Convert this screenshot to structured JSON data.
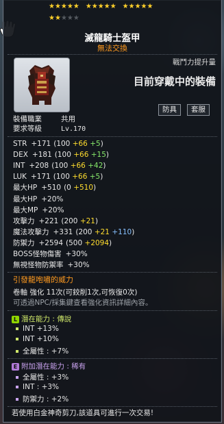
{
  "stars": {
    "row1": [
      "★★★★★",
      "★★★★★",
      "★★★★★"
    ],
    "row2_on": "★★",
    "row2_off": "★★★"
  },
  "item": {
    "name": "滅龍騎士盔甲",
    "trade": "無法交換",
    "power_label": "戰鬥力提升量",
    "power_text": "目前穿戴中的裝備",
    "tags": [
      "防具",
      "套服"
    ],
    "job_label": "裝備職業",
    "job_value": "共用",
    "level_label": "要求等級",
    "level_value": "Lv.170"
  },
  "stats": [
    {
      "name": "STR",
      "total": "+171",
      "base": "(100 ",
      "bonus": "+66",
      "extra": " +5",
      "extra_color": "g",
      "close": ")"
    },
    {
      "name": "DEX",
      "total": "+181",
      "base": "(100 ",
      "bonus": "+66",
      "extra": " +15",
      "extra_color": "g",
      "close": ")"
    },
    {
      "name": "INT",
      "total": "+208",
      "base": "(100 ",
      "bonus": "+66",
      "extra": " +42",
      "extra_color": "g",
      "close": ")"
    },
    {
      "name": "LUK",
      "total": "+171",
      "base": "(100 ",
      "bonus": "+66",
      "extra": " +5",
      "extra_color": "g",
      "close": ")"
    },
    {
      "name": "最大HP",
      "total": "+510",
      "base": "(0 ",
      "bonus": "+510",
      "extra": "",
      "extra_color": "",
      "close": ")"
    },
    {
      "name": "最大HP",
      "total": "+20%",
      "base": "",
      "bonus": "",
      "extra": "",
      "extra_color": "",
      "close": ""
    },
    {
      "name": "最大MP",
      "total": "+20%",
      "base": "",
      "bonus": "",
      "extra": "",
      "extra_color": "",
      "close": ""
    },
    {
      "name": "攻擊力",
      "total": "+221",
      "base": "(200 ",
      "bonus": "+21",
      "extra": "",
      "extra_color": "",
      "close": ")"
    },
    {
      "name": "魔法攻擊力",
      "total": "+331",
      "base": "(200 ",
      "bonus": "+21",
      "extra": " +110",
      "extra_color": "c",
      "close": ")"
    },
    {
      "name": "防禦力",
      "total": "+2594",
      "base": "(500 ",
      "bonus": "+2094",
      "extra": "",
      "extra_color": "",
      "close": ")"
    },
    {
      "name": "BOSS怪物傷害",
      "total": "+30%",
      "base": "",
      "bonus": "",
      "extra": "",
      "extra_color": "",
      "close": ""
    },
    {
      "name": "無視怪物防禦率",
      "total": "+30%",
      "base": "",
      "bonus": "",
      "extra": "",
      "extra_color": "",
      "close": ""
    }
  ],
  "effect_title": "引發龍咆嘯的威力",
  "scroll_text": "卷軸 強化 11次(可鉸削1次,可恢復0次)",
  "npc_text": "可透過NPC/採集鍵查看強化資訊詳細內容。",
  "potential": {
    "title": "潛在能力 : 傳說",
    "badge": "L",
    "badge_color": "#8fd400",
    "lines": [
      "INT +13%",
      "INT +10%",
      "全屬性 : +7%"
    ]
  },
  "additional": {
    "title": "附加潛在能力 : 稀有",
    "badge": "E",
    "badge_color": "#b07ad8",
    "lines": [
      "全屬性 : +3%",
      "INT : +3%",
      "防禦力 : +2%"
    ]
  },
  "footer": "若使用白金神奇剪刀,該道具可進行一次交易!",
  "colors": {
    "orange": "#ff9a1f",
    "yellow": "#ffdd2e",
    "green": "#86e86a",
    "blue": "#86c0ff"
  }
}
